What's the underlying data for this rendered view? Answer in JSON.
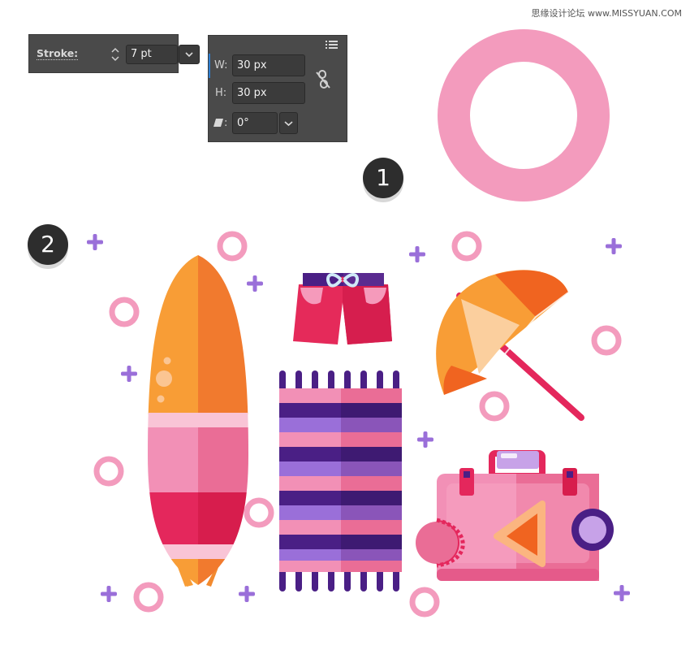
{
  "watermark": "思缘设计论坛 www.MISSYUAN.COM",
  "stroke_panel": {
    "label": "Stroke:",
    "value": "7 pt"
  },
  "size_panel": {
    "w_label": "W:",
    "w_value": "30 px",
    "h_label": "H:",
    "h_value": "30 px",
    "angle_label": ":",
    "angle_value": "0°"
  },
  "steps": [
    "1",
    "2"
  ],
  "colors": {
    "panel_bg": "#4a4a4a",
    "ring_pink": "#f39bbd",
    "plus_purple": "#9a6fd9",
    "orange": "#f89d36",
    "dark_orange": "#f06420",
    "pink": "#f290b6",
    "deep_pink": "#e4275c",
    "dark_purple": "#4a1f85"
  },
  "icons": [
    "menu-icon",
    "link-icon",
    "shear-icon",
    "chevron-down-icon",
    "spinner-icon"
  ]
}
